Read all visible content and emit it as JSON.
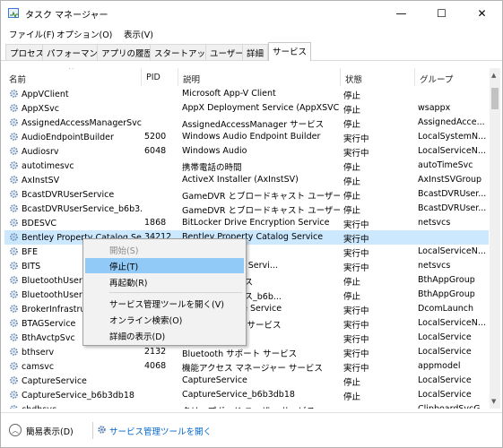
{
  "window": {
    "title": "タスク マネージャー",
    "controls": {
      "minimize": "—",
      "maximize": "☐",
      "close": "✕"
    }
  },
  "menu": [
    "ファイル(F)",
    "オプション(O)",
    "表示(V)"
  ],
  "tabs": [
    "プロセス",
    "パフォーマンス",
    "アプリの履歴",
    "スタートアップ",
    "ユーザー",
    "詳細",
    "サービス"
  ],
  "active_tab": "サービス",
  "columns": {
    "name": "名前",
    "pid": "PID",
    "desc": "説明",
    "status": "状態",
    "group": "グループ"
  },
  "rows": [
    {
      "name": "AppVClient",
      "pid": "",
      "desc": "Microsoft App-V Client",
      "status": "停止",
      "group": ""
    },
    {
      "name": "AppXSvc",
      "pid": "",
      "desc": "AppX Deployment Service (AppXSVC)",
      "status": "停止",
      "group": "wsappx"
    },
    {
      "name": "AssignedAccessManagerSvc",
      "pid": "",
      "desc": "AssignedAccessManager サービス",
      "status": "停止",
      "group": "AssignedAcce..."
    },
    {
      "name": "AudioEndpointBuilder",
      "pid": "5200",
      "desc": "Windows Audio Endpoint Builder",
      "status": "実行中",
      "group": "LocalSystemN..."
    },
    {
      "name": "Audiosrv",
      "pid": "6048",
      "desc": "Windows Audio",
      "status": "実行中",
      "group": "LocalServiceN..."
    },
    {
      "name": "autotimesvc",
      "pid": "",
      "desc": "携帯電話の時間",
      "status": "停止",
      "group": "autoTimeSvc"
    },
    {
      "name": "AxInstSV",
      "pid": "",
      "desc": "ActiveX Installer (AxInstSV)",
      "status": "停止",
      "group": "AxInstSVGroup"
    },
    {
      "name": "BcastDVRUserService",
      "pid": "",
      "desc": "GameDVR とブロードキャスト ユーザー サー...",
      "status": "停止",
      "group": "BcastDVRUser..."
    },
    {
      "name": "BcastDVRUserService_b6b3...",
      "pid": "",
      "desc": "GameDVR とブロードキャスト ユーザー サー...",
      "status": "停止",
      "group": "BcastDVRUser..."
    },
    {
      "name": "BDESVC",
      "pid": "1868",
      "desc": "BitLocker Drive Encryption Service",
      "status": "実行中",
      "group": "netsvcs"
    },
    {
      "name": "Bentley Property Catalog Se...",
      "pid": "34212",
      "desc": "Bentley Property Catalog Service",
      "status": "実行中",
      "group": ""
    },
    {
      "name": "BFE",
      "pid": "",
      "desc": "gine",
      "status": "実行中",
      "group": "LocalServiceN..."
    },
    {
      "name": "BITS",
      "pid": "",
      "desc": "lligent Transfer Servi...",
      "status": "実行中",
      "group": "netsvcs"
    },
    {
      "name": "BluetoothUserSe",
      "pid": "",
      "desc": "サポート サービス",
      "status": "停止",
      "group": "BthAppGroup"
    },
    {
      "name": "BluetoothUserSe",
      "pid": "",
      "desc": "サポート サービス_b6b...",
      "status": "停止",
      "group": "BthAppGroup"
    },
    {
      "name": "BrokerInfrastruc",
      "pid": "",
      "desc": "s Infrastructure Service",
      "status": "実行中",
      "group": "DcomLaunch"
    },
    {
      "name": "BTAGService",
      "pid": "",
      "desc": "オ ゲートウェイ サービス",
      "status": "実行中",
      "group": "LocalServiceN..."
    },
    {
      "name": "BthAvctpSvc",
      "pid": "",
      "desc": "",
      "status": "実行中",
      "group": "LocalService"
    },
    {
      "name": "bthserv",
      "pid": "2132",
      "desc": "Bluetooth サポート サービス",
      "status": "実行中",
      "group": "LocalService"
    },
    {
      "name": "camsvc",
      "pid": "4068",
      "desc": "機能アクセス マネージャー サービス",
      "status": "実行中",
      "group": "appmodel"
    },
    {
      "name": "CaptureService",
      "pid": "",
      "desc": "CaptureService",
      "status": "停止",
      "group": "LocalService"
    },
    {
      "name": "CaptureService_b6b3db18",
      "pid": "",
      "desc": "CaptureService_b6b3db18",
      "status": "停止",
      "group": "LocalService"
    },
    {
      "name": "cbdhsvc",
      "pid": "",
      "desc": "クリップボード ユーザー サービス",
      "status": "",
      "group": "ClipboardSvcG..."
    }
  ],
  "context_menu": {
    "items": [
      {
        "label": "開始(S)",
        "disabled": true,
        "highlighted": false
      },
      {
        "label": "停止(T)",
        "disabled": false,
        "highlighted": true
      },
      {
        "label": "再起動(R)",
        "disabled": false,
        "highlighted": false
      },
      {
        "label": "サービス管理ツールを開く(V)",
        "disabled": false,
        "highlighted": false
      },
      {
        "label": "オンライン検索(O)",
        "disabled": false,
        "highlighted": false
      },
      {
        "label": "詳細の表示(D)",
        "disabled": false,
        "highlighted": false
      }
    ]
  },
  "footer": {
    "fewer_details": "簡易表示(D)",
    "open_services": "サービス管理ツールを開く"
  },
  "colors": {
    "selection": "#cce8ff",
    "menu_highlight": "#91c9f7",
    "link": "#0066cc"
  }
}
